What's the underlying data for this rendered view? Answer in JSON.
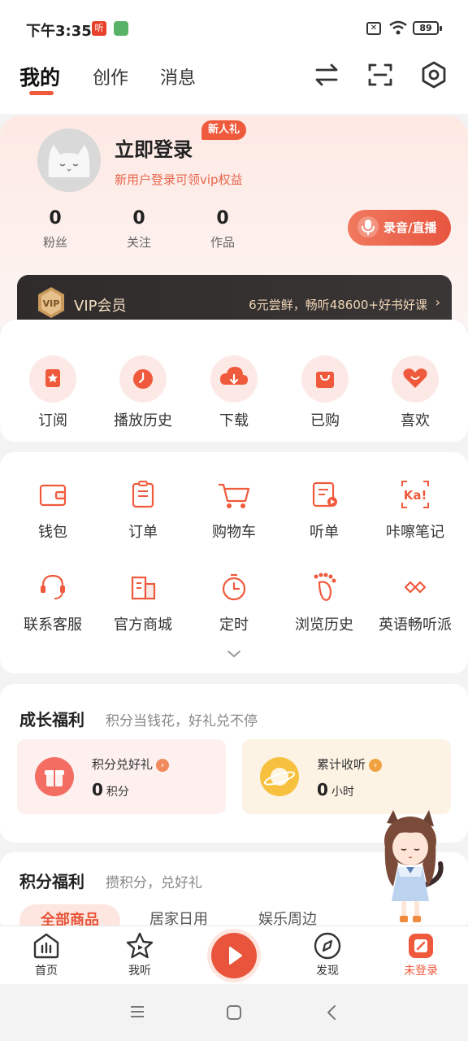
{
  "status_bar": {
    "time": "下午3:35",
    "battery": "89",
    "app1_glyph": "听"
  },
  "top_nav": {
    "tabs": [
      "我的",
      "创作",
      "消息"
    ]
  },
  "profile": {
    "login_title": "立即登录",
    "newbie_badge": "新人礼",
    "login_subtitle": "新用户登录可领vip权益",
    "stats": [
      {
        "value": "0",
        "label": "粉丝"
      },
      {
        "value": "0",
        "label": "关注"
      },
      {
        "value": "0",
        "label": "作品"
      }
    ],
    "record_button": "录音/直播"
  },
  "vip": {
    "logo_text": "VIP",
    "title": "VIP会员",
    "promo": "6元尝鲜，畅听48600+好书好课",
    "arrow": "›"
  },
  "quick_actions": [
    "订阅",
    "播放历史",
    "下载",
    "已购",
    "喜欢"
  ],
  "services": [
    "钱包",
    "订单",
    "购物车",
    "听单",
    "咔嚓笔记",
    "联系客服",
    "官方商城",
    "定时",
    "浏览历史",
    "英语畅听派"
  ],
  "growth": {
    "title": "成长福利",
    "subtitle": "积分当钱花，好礼兑不停",
    "cards": [
      {
        "title": "积分兑好礼",
        "value": "0",
        "unit": "积分"
      },
      {
        "title": "累计收听",
        "value": "0",
        "unit": "小时"
      }
    ]
  },
  "points": {
    "title": "积分福利",
    "subtitle": "攒积分，兑好礼",
    "tabs": [
      "全部商品",
      "居家日用",
      "娱乐周边"
    ]
  },
  "bottom_nav": [
    "首页",
    "我听",
    "发现",
    "未登录"
  ],
  "colors": {
    "accent": "#e8553c",
    "vip_bg": "#2f2b2b",
    "vip_text": "#f4ddc1"
  }
}
